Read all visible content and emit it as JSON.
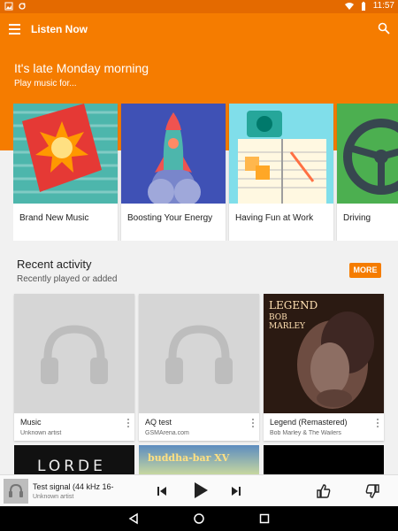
{
  "status_bar": {
    "time": "11:57"
  },
  "app_bar": {
    "title": "Listen Now",
    "menu_icon": "hamburger-menu-icon",
    "search_icon": "search-icon"
  },
  "hero": {
    "title": "It's late Monday morning",
    "subtitle": "Play music for..."
  },
  "playlists": [
    {
      "label": "Brand New Music"
    },
    {
      "label": "Boosting Your Energy"
    },
    {
      "label": "Having Fun at Work"
    },
    {
      "label": "Driving"
    }
  ],
  "recent": {
    "title": "Recent activity",
    "subtitle": "Recently played or added",
    "more_label": "MORE",
    "items": [
      {
        "name": "Music",
        "artist": "Unknown artist"
      },
      {
        "name": "AQ test",
        "artist": "GSMArena.com"
      },
      {
        "name": "Legend (Remastered)",
        "artist": "Bob Marley & The Wailers",
        "cover_line1": "LEGEND",
        "cover_line2": "BOB",
        "cover_line3": "MARLEY"
      }
    ],
    "row2": [
      {
        "cover_text": "LORDE"
      },
      {
        "cover_text": "buddha-bar XV"
      }
    ]
  },
  "now_playing": {
    "title": "Test signal (44 kHz 16-",
    "artist": "Unknown artist"
  },
  "colors": {
    "accent": "#f57c00",
    "status": "#e46a00"
  }
}
